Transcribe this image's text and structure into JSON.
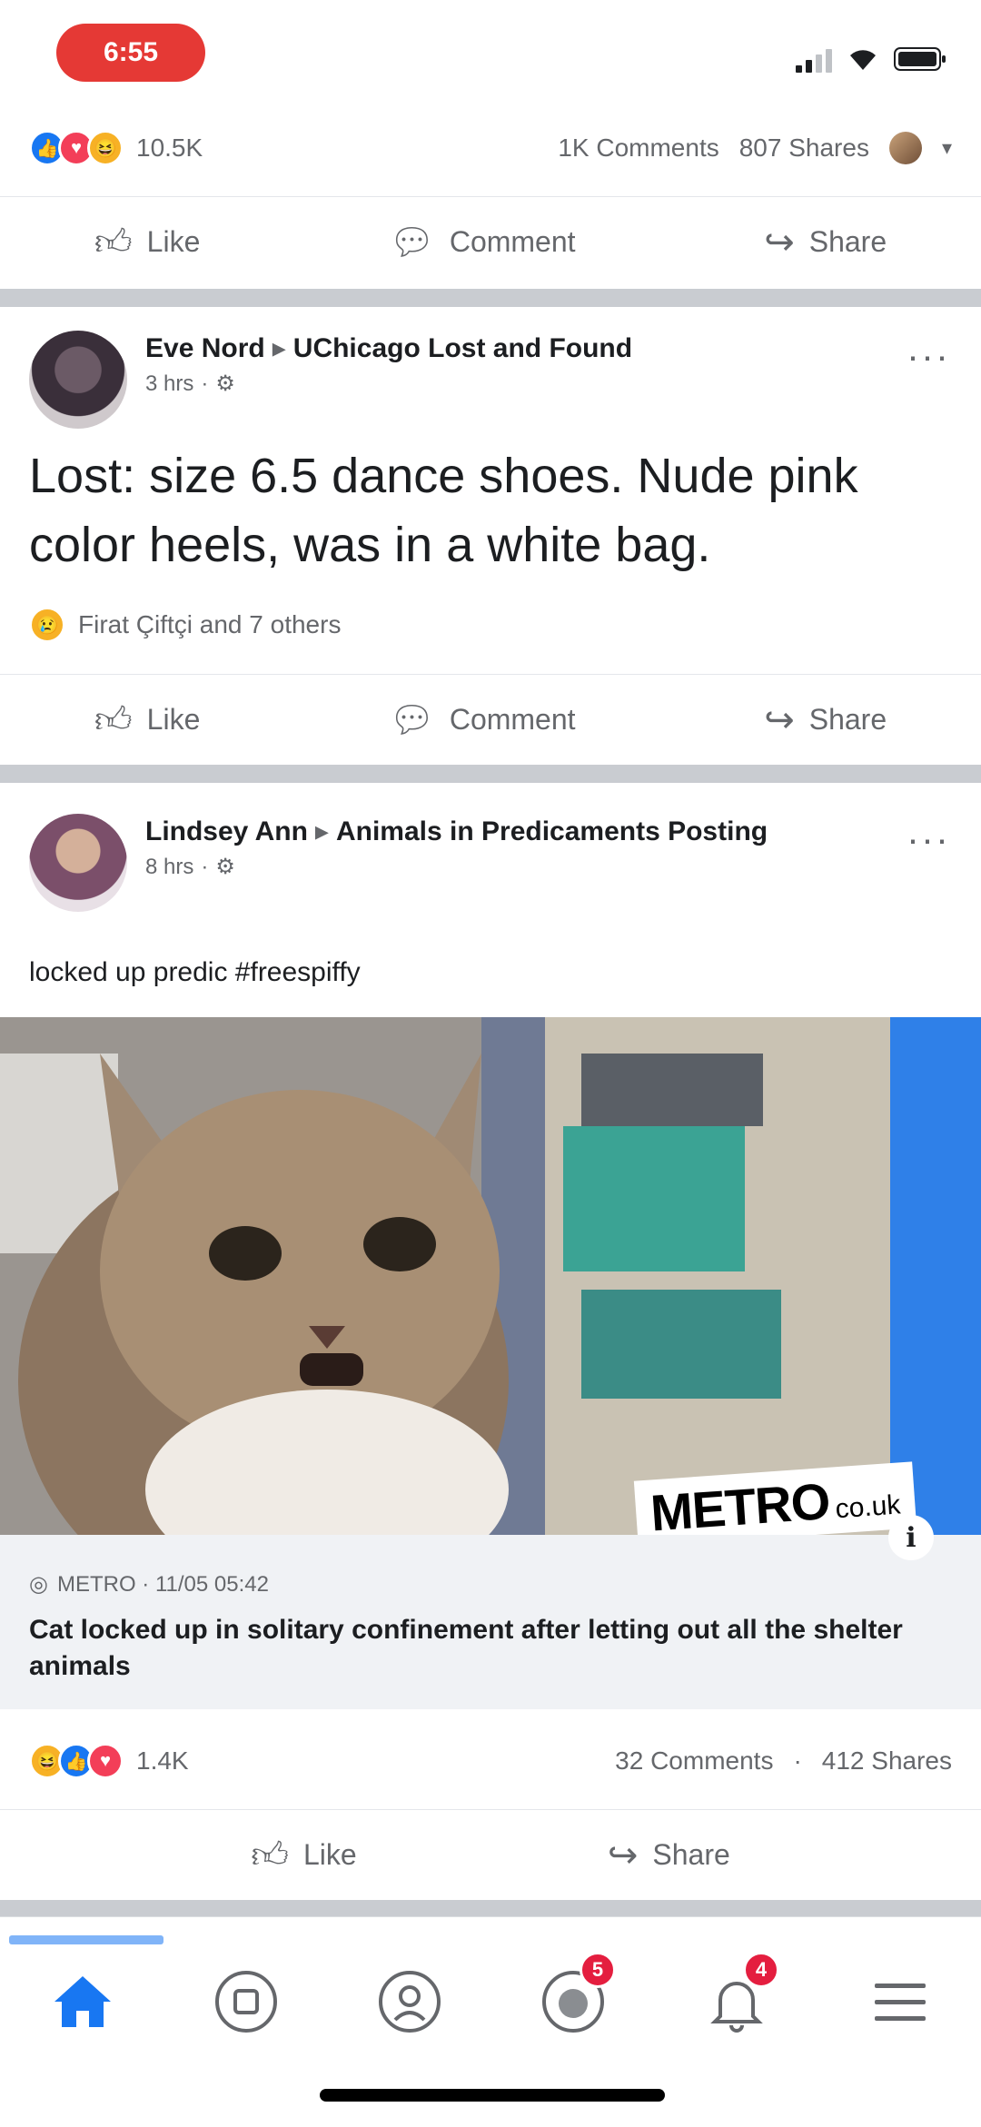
{
  "status_bar": {
    "time": "6:55"
  },
  "post1": {
    "reaction_count": "10.5K",
    "comments": "1K Comments",
    "shares": "807 Shares"
  },
  "actions": {
    "like": "Like",
    "comment": "Comment",
    "share": "Share"
  },
  "post2": {
    "author": "Eve Nord",
    "arrow": "▸",
    "group": "UChicago Lost and Found",
    "time": "3 hrs",
    "text": "Lost: size 6.5 dance shoes. Nude pink color heels, was in a white bag.",
    "reactions_text": "Firat Çiftçi and 7 others"
  },
  "post3": {
    "author": "Lindsey Ann",
    "arrow": "▸",
    "group": "Animals in Predicaments Posting",
    "time": "8 hrs",
    "text": "locked up predic #freespiffy",
    "watermark": "METRO",
    "watermark_suffix": "co.uk",
    "link_source": "METRO · 11/05 05:42",
    "link_title": "Cat locked up in solitary confinement after letting out all the shelter animals",
    "reaction_count": "1.4K",
    "comments": "32 Comments",
    "shares": "412 Shares"
  },
  "tab_bar": {
    "items": [
      {
        "name": "home-tab",
        "icon": "home-icon",
        "badge": ""
      },
      {
        "name": "watch-tab",
        "icon": "watch-icon",
        "badge": ""
      },
      {
        "name": "profile-tab",
        "icon": "profile-icon",
        "badge": ""
      },
      {
        "name": "groups-tab",
        "icon": "groups-icon",
        "badge": "5"
      },
      {
        "name": "notifications-tab",
        "icon": "bell-icon",
        "badge": "4"
      },
      {
        "name": "menu-tab",
        "icon": "menu-icon",
        "badge": ""
      }
    ]
  },
  "colors": {
    "accent": "#1877f2",
    "badge": "#e41e3f",
    "separator": "#c9ccd1"
  }
}
